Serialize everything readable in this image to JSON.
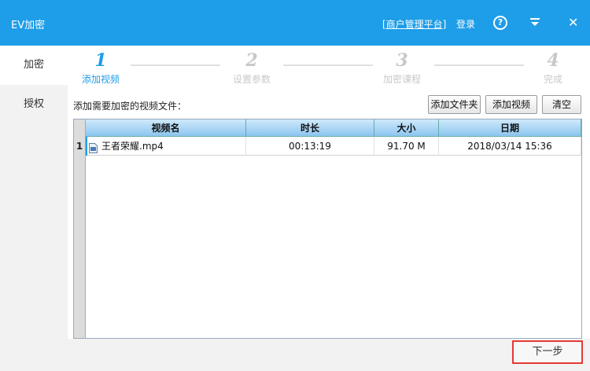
{
  "titlebar": {
    "app_title": "EV加密",
    "merchant_link": "[商户管理平台]",
    "login": "登录",
    "help_glyph": "?",
    "close_glyph": "✕",
    "background": "#1e9de8"
  },
  "sidebar": {
    "tabs": [
      {
        "label": "加密",
        "active": true
      },
      {
        "label": "授权",
        "active": false
      }
    ]
  },
  "steps": [
    {
      "num": "1",
      "label": "添加视频",
      "active": true
    },
    {
      "num": "2",
      "label": "设置参数",
      "active": false
    },
    {
      "num": "3",
      "label": "加密课程",
      "active": false
    },
    {
      "num": "4",
      "label": "完成",
      "active": false
    }
  ],
  "toolbar": {
    "label": "添加需要加密的视频文件：",
    "add_folder": "添加文件夹",
    "add_video": "添加视频",
    "clear": "清空"
  },
  "grid": {
    "columns": [
      "视频名",
      "时长",
      "大小",
      "日期"
    ],
    "rows": [
      {
        "index": "1",
        "name": "王者荣耀.mp4",
        "duration": "00:13:19",
        "size": "91.70 M",
        "date": "2018/03/14 15:36"
      }
    ]
  },
  "footer": {
    "next": "下一步"
  },
  "colors": {
    "accent": "#1e9de8",
    "highlight_border": "#e53935"
  },
  "icons": {
    "help": "help-circle-icon",
    "menu": "dropdown-menu-icon",
    "close": "close-icon",
    "file": "video-file-icon"
  }
}
